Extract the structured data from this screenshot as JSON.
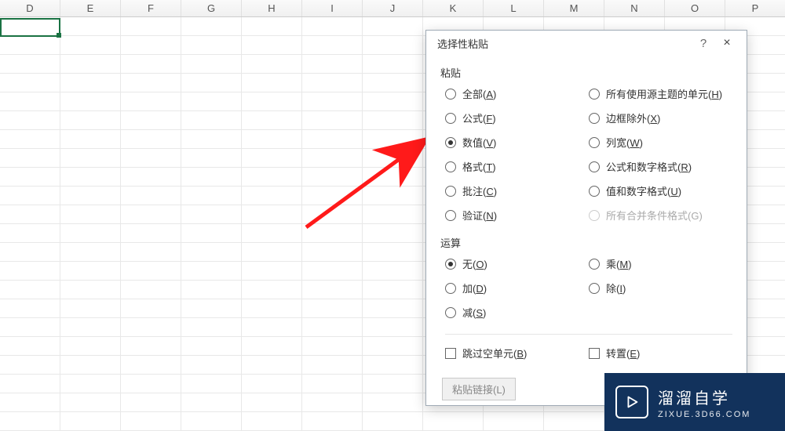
{
  "columns": [
    "D",
    "E",
    "F",
    "G",
    "H",
    "I",
    "J",
    "K",
    "L",
    "M",
    "N",
    "O",
    "P"
  ],
  "active_cell": {
    "col": "D",
    "row": 1
  },
  "dialog": {
    "title": "选择性粘贴",
    "help_symbol": "?",
    "close_symbol": "×",
    "paste": {
      "label": "粘贴",
      "options_left": [
        {
          "label": "全部",
          "accel": "A",
          "checked": false
        },
        {
          "label": "公式",
          "accel": "F",
          "checked": false
        },
        {
          "label": "数值",
          "accel": "V",
          "checked": true
        },
        {
          "label": "格式",
          "accel": "T",
          "checked": false
        },
        {
          "label": "批注",
          "accel": "C",
          "checked": false
        },
        {
          "label": "验证",
          "accel": "N",
          "checked": false
        }
      ],
      "options_right": [
        {
          "label": "所有使用源主题的单元",
          "accel": "H",
          "checked": false,
          "disabled": false
        },
        {
          "label": "边框除外",
          "accel": "X",
          "checked": false,
          "disabled": false
        },
        {
          "label": "列宽",
          "accel": "W",
          "checked": false,
          "disabled": false
        },
        {
          "label": "公式和数字格式",
          "accel": "R",
          "checked": false,
          "disabled": false
        },
        {
          "label": "值和数字格式",
          "accel": "U",
          "checked": false,
          "disabled": false
        },
        {
          "label": "所有合并条件格式(G)",
          "accel": "",
          "checked": false,
          "disabled": true
        }
      ]
    },
    "operation": {
      "label": "运算",
      "options_left": [
        {
          "label": "无",
          "accel": "O",
          "checked": true
        },
        {
          "label": "加",
          "accel": "D",
          "checked": false
        },
        {
          "label": "减",
          "accel": "S",
          "checked": false
        }
      ],
      "options_right": [
        {
          "label": "乘",
          "accel": "M",
          "checked": false
        },
        {
          "label": "除",
          "accel": "I",
          "checked": false
        }
      ]
    },
    "checks": {
      "skip_blanks": {
        "label": "跳过空单元",
        "accel": "B",
        "checked": false
      },
      "transpose": {
        "label": "转置",
        "accel": "E",
        "checked": false
      }
    },
    "buttons": {
      "paste_link": "粘贴链接(L)",
      "ok": ""
    }
  },
  "watermark": {
    "line1": "溜溜自学",
    "line2": "ZIXUE.3D66.COM"
  }
}
